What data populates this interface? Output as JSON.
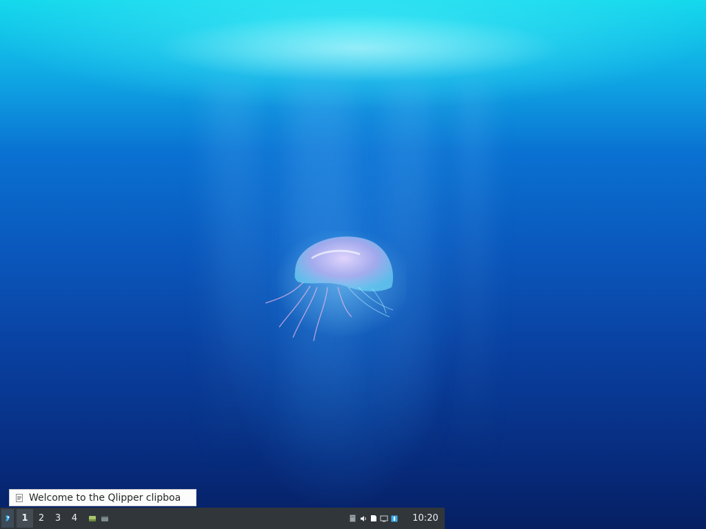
{
  "wallpaper": {
    "description_icon": "jellyfish-wallpaper",
    "colors": {
      "surface": "#14d9ec",
      "deep": "#061f62"
    }
  },
  "notification": {
    "text": "Welcome to the Qlipper clipboa",
    "icon": "document-icon"
  },
  "taskbar": {
    "start_icon": "lxqt-menu-icon",
    "desktops": [
      {
        "label": "1",
        "active": true
      },
      {
        "label": "2",
        "active": false
      },
      {
        "label": "3",
        "active": false
      },
      {
        "label": "4",
        "active": false
      }
    ],
    "quicklaunch": [
      "show-desktop-icon",
      "window-switcher-icon"
    ],
    "tray": [
      "clipboard-icon",
      "volume-icon",
      "notes-icon",
      "network-icon",
      "update-icon"
    ],
    "clock": "10:20",
    "colors": {
      "background": "#31363b",
      "active_desktop": "#454c54",
      "text": "#eff0f1"
    }
  }
}
